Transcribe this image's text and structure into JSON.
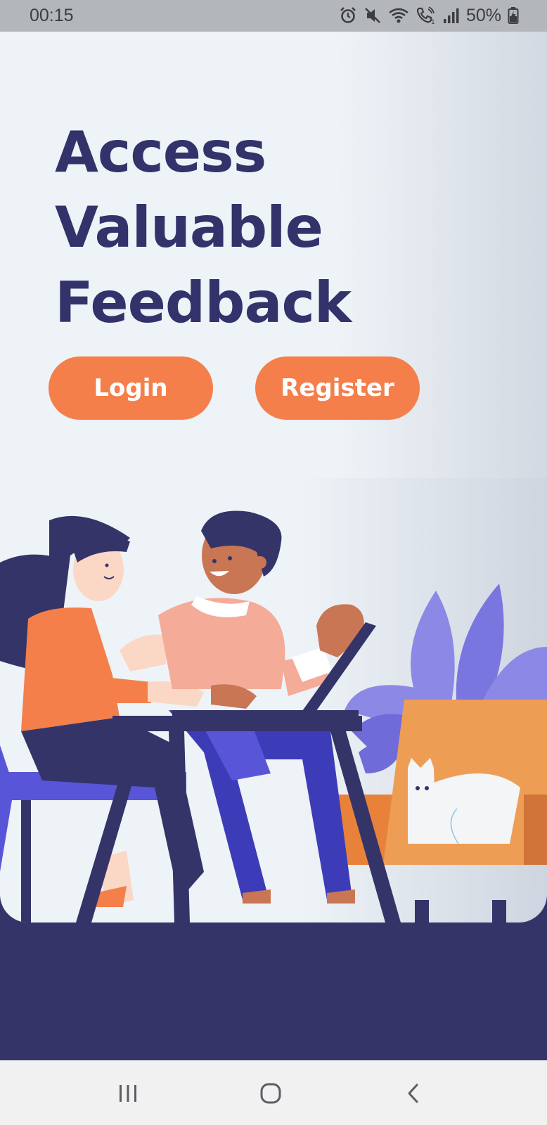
{
  "status_bar": {
    "time": "00:15",
    "battery": "50%",
    "icons": [
      "alarm-icon",
      "mute-icon",
      "wifi-icon",
      "wifi-calling-icon",
      "signal-icon",
      "battery-charging-icon"
    ]
  },
  "hero": {
    "headline_lines": [
      "Access",
      "Valuable",
      "Feedback"
    ],
    "login_label": "Login",
    "register_label": "Register"
  },
  "colors": {
    "headline": "#33326a",
    "button": "#f47f4b",
    "footer": "#353469",
    "status_bar": "#b3b6bb"
  },
  "navigation": {
    "icons": [
      "recents-icon",
      "home-icon",
      "back-icon"
    ]
  }
}
